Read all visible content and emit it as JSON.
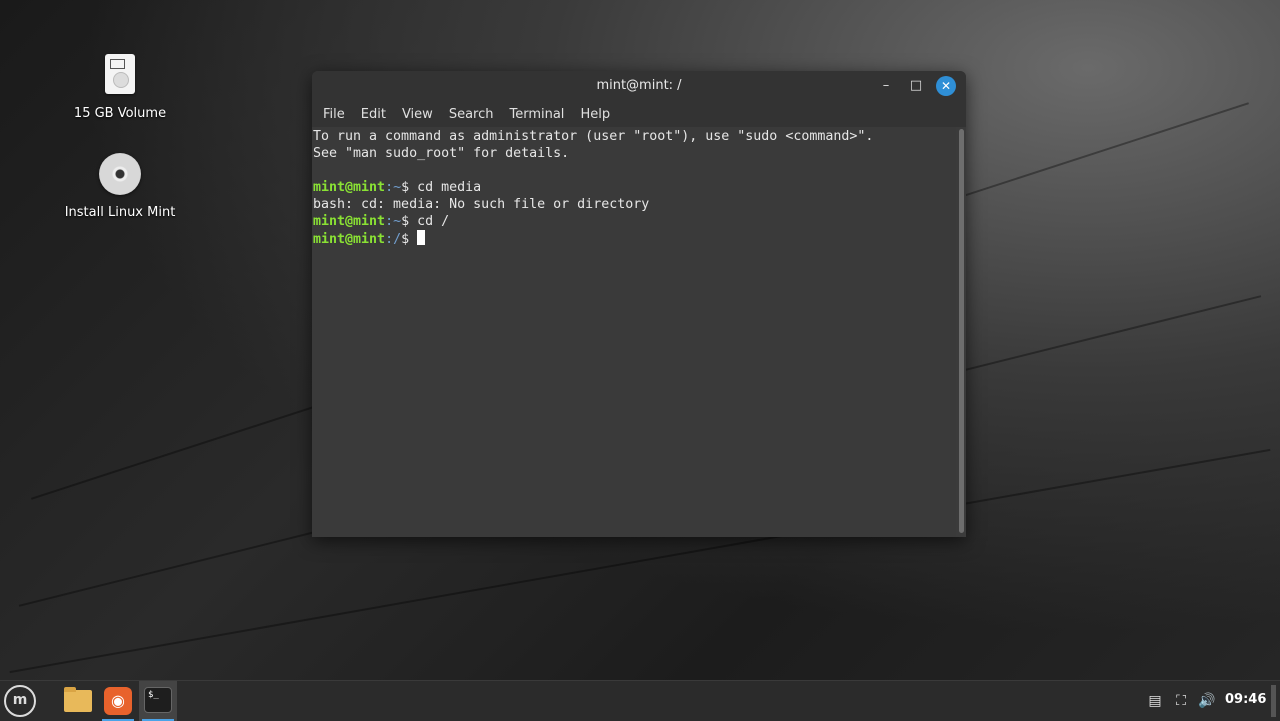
{
  "desktop": {
    "icons": [
      {
        "label": "15 GB Volume",
        "icon": "drive-icon"
      },
      {
        "label": "Install Linux Mint",
        "icon": "cd-icon"
      }
    ]
  },
  "terminal": {
    "title": "mint@mint: /",
    "buttons": {
      "minimize": "–",
      "maximize": "□",
      "close": "✕"
    },
    "menu": [
      "File",
      "Edit",
      "View",
      "Search",
      "Terminal",
      "Help"
    ],
    "lines": {
      "l1": "To run a command as administrator (user \"root\"), use \"sudo <command>\".",
      "l2": "See \"man sudo_root\" for details.",
      "l4_user": "mint@mint",
      "l4_path": ":~",
      "l4_cmd": "$ cd media",
      "l5": "bash: cd: media: No such file or directory",
      "l6_user": "mint@mint",
      "l6_path": ":~",
      "l6_cmd": "$ cd /",
      "l7_user": "mint@mint",
      "l7_path": ":/",
      "l7_cmd": "$ "
    }
  },
  "taskbar": {
    "menu_glyph": "m",
    "firefox_glyph": "◉",
    "terminal_glyph": "$_",
    "tray": {
      "notes_icon": "▤",
      "network_icon": "⛶",
      "volume_icon": "🔊"
    },
    "clock": "09:46"
  },
  "colors": {
    "prompt_user": "#8ae234",
    "prompt_path": "#729fcf",
    "accent": "#2f8fd6"
  }
}
